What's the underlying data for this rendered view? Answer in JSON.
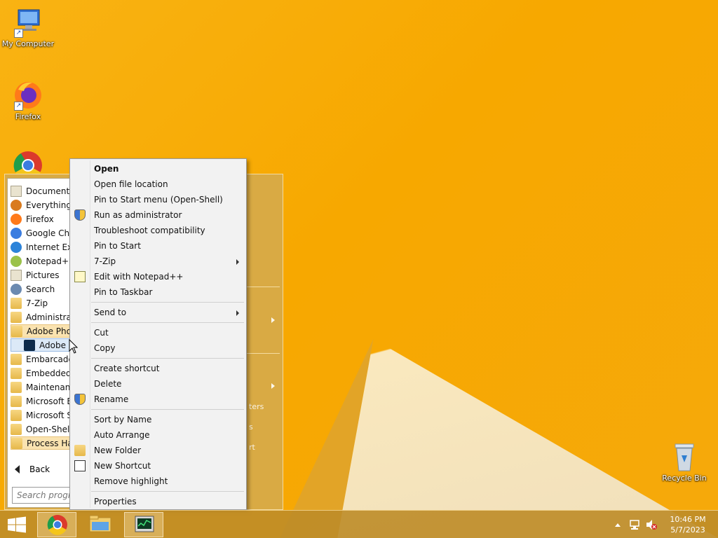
{
  "desktop": {
    "icons": [
      {
        "label": "My Computer"
      },
      {
        "label": "Firefox"
      },
      {
        "label": "Recycle Bin"
      }
    ]
  },
  "start_menu": {
    "programs": [
      {
        "label": "Documents",
        "icon": "documents-icon"
      },
      {
        "label": "Everything",
        "icon": "everything-search-icon"
      },
      {
        "label": "Firefox",
        "icon": "firefox-icon"
      },
      {
        "label": "Google Chr",
        "icon": "chrome-icon"
      },
      {
        "label": "Internet Exp",
        "icon": "internet-explorer-icon"
      },
      {
        "label": "Notepad++",
        "icon": "notepad-plus-plus-icon"
      },
      {
        "label": "Pictures",
        "icon": "pictures-icon"
      },
      {
        "label": "Search",
        "icon": "search-icon"
      },
      {
        "label": "7-Zip",
        "icon": "folder-icon"
      },
      {
        "label": "Administrat",
        "icon": "folder-icon"
      },
      {
        "label": "Adobe Phot",
        "icon": "folder-icon",
        "state": "open"
      },
      {
        "label": "Adobe F",
        "icon": "photoshop-icon",
        "state": "selected"
      },
      {
        "label": "Embarcade",
        "icon": "folder-icon"
      },
      {
        "label": "Embedded",
        "icon": "folder-icon"
      },
      {
        "label": "Maintenanc",
        "icon": "folder-icon"
      },
      {
        "label": "Microsoft E",
        "icon": "folder-icon"
      },
      {
        "label": "Microsoft S",
        "icon": "folder-icon"
      },
      {
        "label": "Open-Shell",
        "icon": "folder-icon"
      },
      {
        "label": "Process Ha",
        "icon": "folder-icon",
        "state": "highlight"
      }
    ],
    "back_label": "Back",
    "search_placeholder": "Search progra",
    "right_pane_fragments": [
      "ters",
      "s",
      "rt"
    ]
  },
  "context_menu": {
    "items": [
      {
        "label": "Open",
        "bold": true
      },
      {
        "label": "Open file location"
      },
      {
        "label": "Pin to Start menu (Open-Shell)"
      },
      {
        "label": "Run as administrator",
        "icon": "uac-shield-icon"
      },
      {
        "label": "Troubleshoot compatibility"
      },
      {
        "label": "Pin to Start"
      },
      {
        "label": "7-Zip",
        "submenu": true
      },
      {
        "label": "Edit with Notepad++",
        "icon": "notepad-plus-plus-icon"
      },
      {
        "label": "Pin to Taskbar"
      },
      {
        "label": "Send to",
        "submenu": true
      },
      {
        "label": "Cut"
      },
      {
        "label": "Copy"
      },
      {
        "label": "Create shortcut"
      },
      {
        "label": "Delete"
      },
      {
        "label": "Rename",
        "icon": "uac-shield-icon"
      },
      {
        "label": "Sort by Name"
      },
      {
        "label": "Auto Arrange"
      },
      {
        "label": "New Folder",
        "icon": "new-folder-icon"
      },
      {
        "label": "New Shortcut",
        "icon": "new-shortcut-icon"
      },
      {
        "label": "Remove highlight"
      },
      {
        "label": "Properties"
      }
    ]
  },
  "taskbar": {
    "start_button": "windows-logo-icon",
    "pinned": [
      "chrome-icon",
      "file-explorer-icon",
      "task-manager-icon"
    ],
    "clock_time": "10:46 PM",
    "clock_date": "5/7/2023"
  },
  "colors": {
    "wallpaper": "#f7a800",
    "menu_background": "#f2f2f2",
    "start_frame": "#d6aa4a"
  }
}
